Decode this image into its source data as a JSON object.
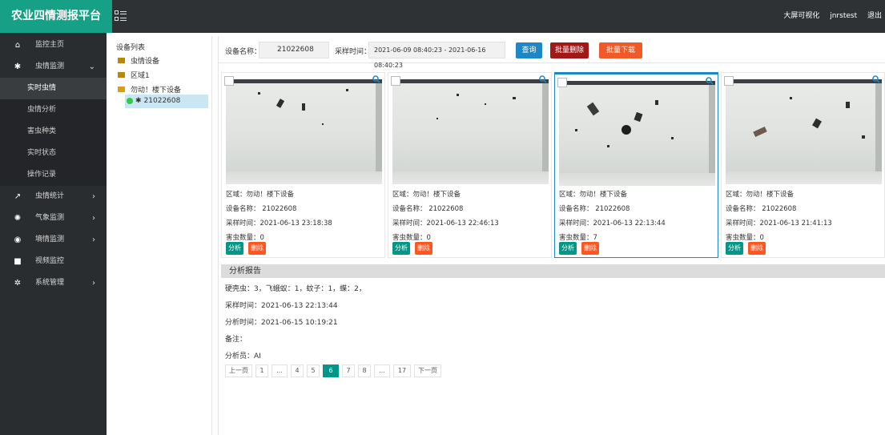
{
  "topbar": {
    "title": "农业四情测报平台",
    "links": [
      "大屏可视化",
      "jnrstest",
      "退出"
    ]
  },
  "sidebar": {
    "items": [
      {
        "label": "监控主页",
        "icon": "home-icon",
        "glyph": "⌂",
        "arrow": ""
      },
      {
        "label": "虫情监测",
        "icon": "bug-icon",
        "glyph": "✱",
        "arrow": "⌄"
      },
      {
        "label": "虫情统计",
        "icon": "line-chart-icon",
        "glyph": "↗",
        "arrow": "›"
      },
      {
        "label": "气象监测",
        "icon": "sun-icon",
        "glyph": "✺",
        "arrow": "›"
      },
      {
        "label": "墒情监测",
        "icon": "globe-icon",
        "glyph": "◉",
        "arrow": "›"
      },
      {
        "label": "视频监控",
        "icon": "video-camera-icon",
        "glyph": "■",
        "arrow": ""
      },
      {
        "label": "系统管理",
        "icon": "gear-icon",
        "glyph": "✲",
        "arrow": "›"
      }
    ],
    "subitems": [
      "实时虫情",
      "虫情分析",
      "害虫种类",
      "实时状态",
      "操作记录"
    ]
  },
  "tree": {
    "title": "设备列表",
    "nodes": [
      "虫情设备",
      "区域1",
      "勿动！楼下设备",
      "21022608"
    ]
  },
  "filter": {
    "device_label": "设备名称：",
    "device_value": "21022608",
    "time_label": "采样时间：",
    "time_value": "2021-06-09 08:40:23 - 2021-06-16 08:40:23",
    "query": "查询",
    "batch_delete": "批量删除",
    "batch_download": "批量下载"
  },
  "cards": [
    {
      "area": "区域：勿动！楼下设备",
      "name": "设备名称： 21022608",
      "time": "采样时间：2021-06-13 23:18:38",
      "count": "害虫数量：0"
    },
    {
      "area": "区域：勿动！楼下设备",
      "name": "设备名称： 21022608",
      "time": "采样时间：2021-06-13 22:46:13",
      "count": "害虫数量：0"
    },
    {
      "area": "区域：勿动！楼下设备",
      "name": "设备名称： 21022608",
      "time": "采样时间：2021-06-13 22:13:44",
      "count": "害虫数量：7"
    },
    {
      "area": "区域：勿动！楼下设备",
      "name": "设备名称： 21022608",
      "time": "采样时间：2021-06-13 21:41:13",
      "count": "害虫数量：0"
    }
  ],
  "card_buttons": {
    "analyze": "分析",
    "delete": "删除"
  },
  "report": {
    "title": "分析报告",
    "result": "硬壳虫：3，飞蛾蚁：1，蚊子：1，蝶：2，",
    "sample_time": "采样时间：2021-06-13 22:13:44",
    "analysis_time": "分析时间：2021-06-15 10:19:21",
    "note": "备注：",
    "analyst": "分析员：AI"
  },
  "pager": {
    "items": [
      "上一页",
      "1",
      "...",
      "4",
      "5",
      "6",
      "7",
      "8",
      "...",
      "17",
      "下一页"
    ],
    "current": "6"
  },
  "colors": {
    "brand": "#16a085",
    "query": "#1e88c7",
    "batch_delete": "#a01818",
    "batch_download": "#f05a28",
    "analyze": "#009688",
    "delete": "#ff5722"
  }
}
